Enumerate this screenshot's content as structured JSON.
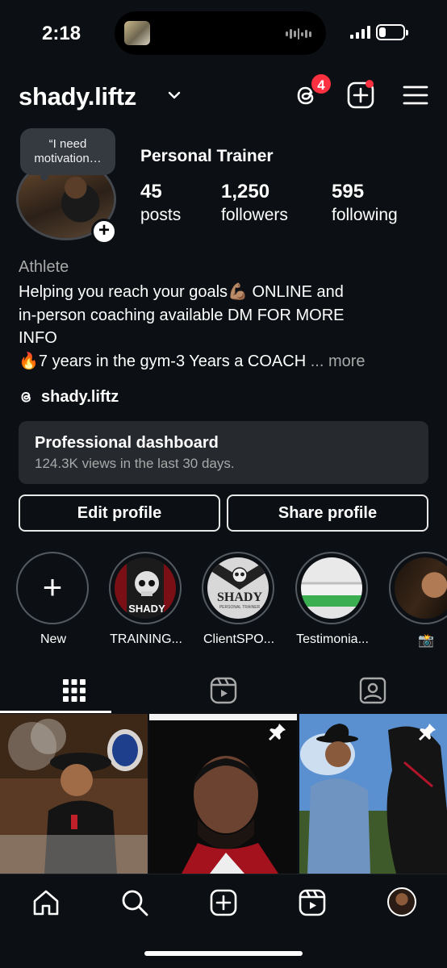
{
  "status_bar": {
    "time": "2:18",
    "battery_level": 0.3
  },
  "header": {
    "username": "shady.liftz",
    "threads_badge": "4"
  },
  "profile": {
    "note": "“I need motivation…",
    "category": "Personal Trainer",
    "stats": [
      {
        "value": "45",
        "label": "posts"
      },
      {
        "value": "1,250",
        "label": "followers"
      },
      {
        "value": "595",
        "label": "following"
      }
    ],
    "bio_category": "Athlete",
    "bio_lines": [
      "Helping you reach your goals💪🏽 ONLINE and",
      "in-person coaching available DM FOR MORE",
      "INFO",
      "🔥7 years in the gym-3 Years a COACH"
    ],
    "more_label": "... more",
    "threads_handle": "shady.liftz"
  },
  "dashboard": {
    "title": "Professional dashboard",
    "subtitle": "124.3K views in the last 30 days."
  },
  "buttons": {
    "edit": "Edit profile",
    "share": "Share profile"
  },
  "highlights": [
    {
      "label": "New"
    },
    {
      "label": "TRAINING..."
    },
    {
      "label": "ClientSPO..."
    },
    {
      "label": "Testimonia..."
    },
    {
      "label": "📸"
    }
  ],
  "highlight_texts": {
    "shady_logo_text": "SHADY",
    "shady_logo_sub": "PERSONAL TRAINER"
  },
  "colors": {
    "background": "#0c1014",
    "badge": "#ff3040",
    "secondary_text": "#a8a8a8",
    "dashboard_bg": "#262a2f"
  }
}
